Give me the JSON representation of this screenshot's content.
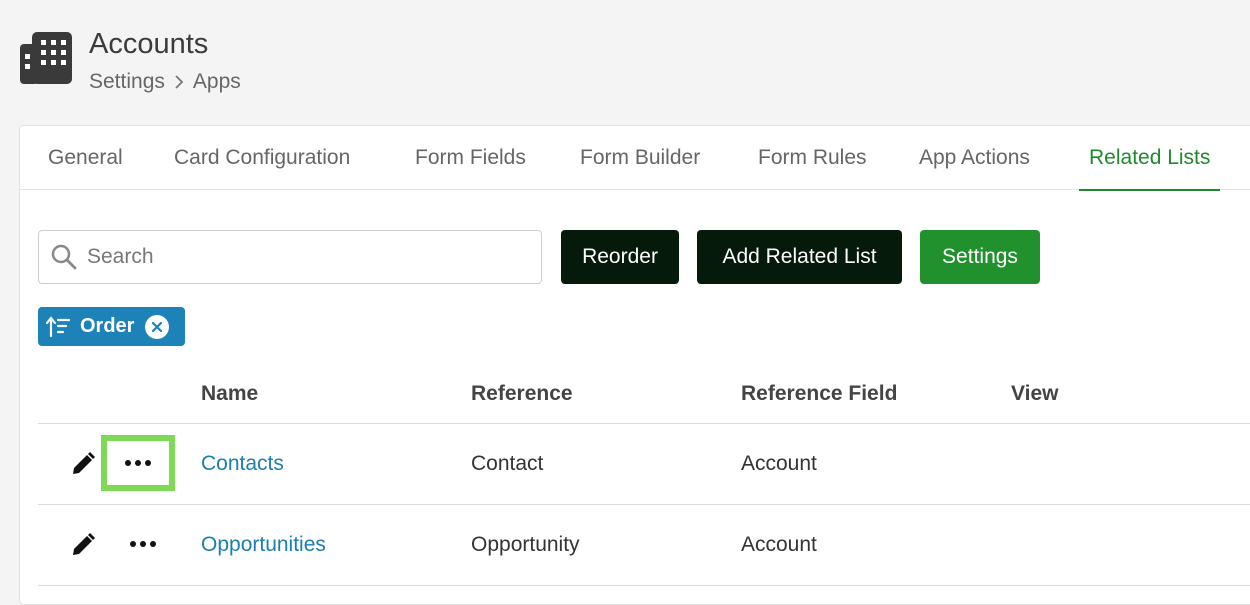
{
  "header": {
    "title": "Accounts",
    "breadcrumb": [
      "Settings",
      "Apps"
    ],
    "icon": "building-icon"
  },
  "tabs": [
    {
      "label": "General",
      "active": false
    },
    {
      "label": "Card Configuration",
      "active": false
    },
    {
      "label": "Form Fields",
      "active": false
    },
    {
      "label": "Form Builder",
      "active": false
    },
    {
      "label": "Form Rules",
      "active": false
    },
    {
      "label": "App Actions",
      "active": false
    },
    {
      "label": "Related Lists",
      "active": true
    }
  ],
  "toolbar": {
    "search_placeholder": "Search",
    "reorder_label": "Reorder",
    "add_label": "Add Related List",
    "settings_label": "Settings"
  },
  "filter_chip": {
    "label": "Order",
    "icon": "sort-icon"
  },
  "table": {
    "columns": [
      "Name",
      "Reference",
      "Reference Field",
      "View"
    ],
    "rows": [
      {
        "name": "Contacts",
        "reference": "Contact",
        "reference_field": "Account",
        "view": ""
      },
      {
        "name": "Opportunities",
        "reference": "Opportunity",
        "reference_field": "Account",
        "view": ""
      }
    ]
  },
  "colors": {
    "accent_green": "#21912d",
    "active_tab": "#1f8a2a",
    "chip_blue": "#1c82b8",
    "link_blue": "#1a7fae",
    "dark_button": "#061a0c",
    "highlight": "#7ed957"
  }
}
